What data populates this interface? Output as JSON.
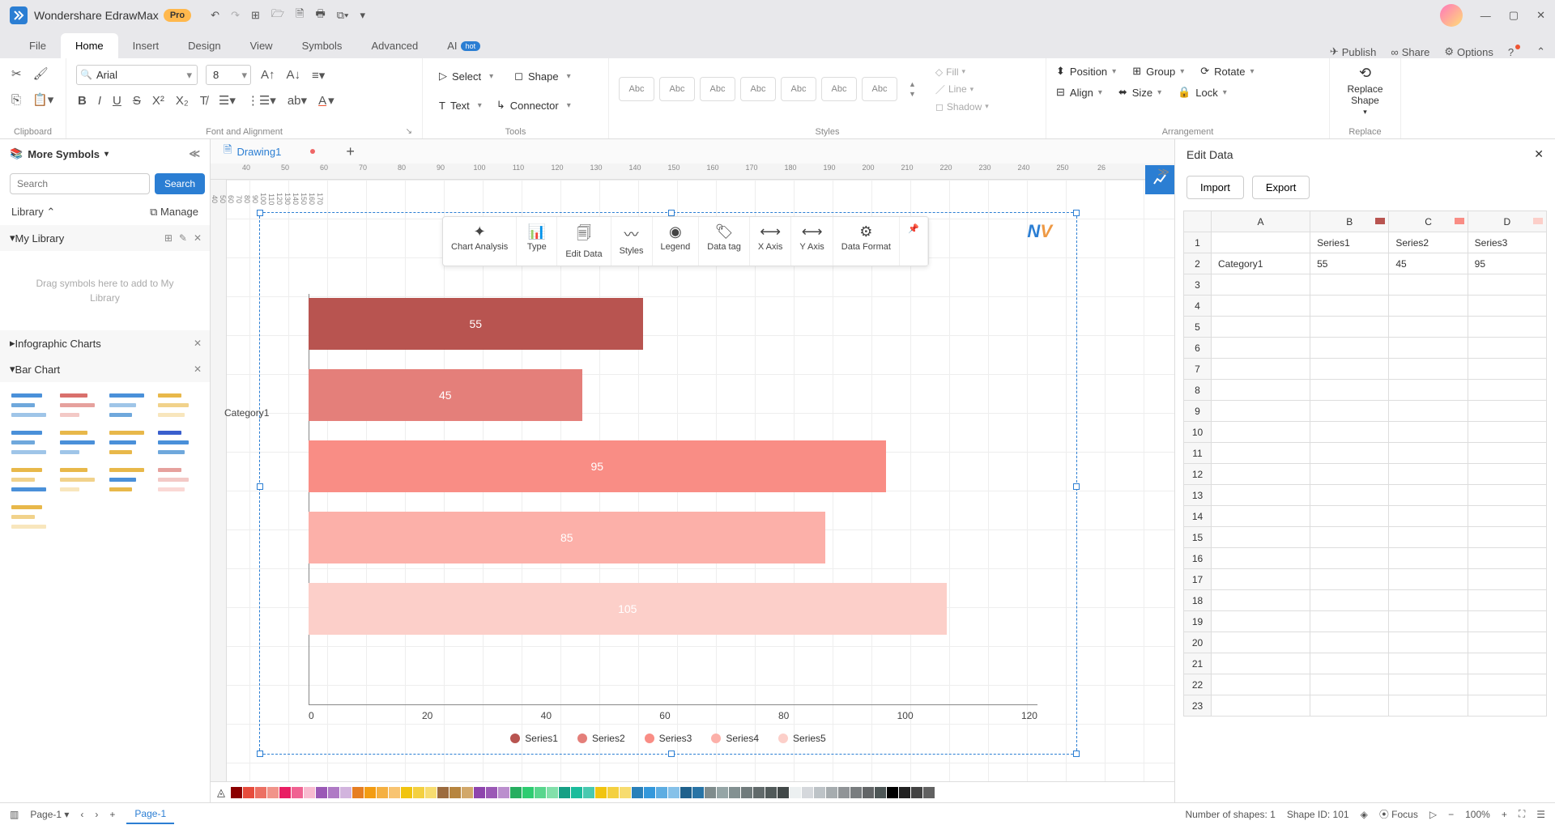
{
  "app": {
    "name": "Wondershare EdrawMax",
    "badge": "Pro"
  },
  "window_controls": {
    "minimize": "—",
    "maximize": "▢",
    "close": "✕"
  },
  "qat": [
    "↶",
    "↷",
    "⊞",
    "🗁",
    "🗎",
    "🖶",
    "⧉▾",
    "▾"
  ],
  "main_tabs": {
    "items": [
      "File",
      "Home",
      "Insert",
      "Design",
      "View",
      "Symbols",
      "Advanced"
    ],
    "active": "Home",
    "ai_label": "AI",
    "ai_badge": "hot"
  },
  "top_right_actions": {
    "publish": "Publish",
    "share": "Share",
    "options": "Options"
  },
  "ribbon": {
    "clipboard": {
      "label": "Clipboard"
    },
    "font_align": {
      "label": "Font and Alignment",
      "font": "Arial",
      "size": "8"
    },
    "tools": {
      "label": "Tools",
      "select": "Select",
      "shape": "Shape",
      "text": "Text",
      "connector": "Connector"
    },
    "styles": {
      "label": "Styles",
      "sample": "Abc",
      "count": 7,
      "fill": "Fill",
      "line": "Line",
      "shadow": "Shadow"
    },
    "arrangement": {
      "label": "Arrangement",
      "position": "Position",
      "group": "Group",
      "rotate": "Rotate",
      "align": "Align",
      "size": "Size",
      "lock": "Lock"
    },
    "replace": {
      "label": "Replace",
      "button": "Replace Shape"
    }
  },
  "doc_tabs": {
    "active": "Drawing1"
  },
  "ruler_h": [
    "40",
    "50",
    "60",
    "70",
    "80",
    "90",
    "100",
    "110",
    "120",
    "130",
    "140",
    "150",
    "160",
    "170",
    "180",
    "190",
    "200",
    "210",
    "220",
    "230",
    "240",
    "250",
    "26"
  ],
  "ruler_v": [
    "40",
    "50",
    "60",
    "70",
    "80",
    "90",
    "100",
    "110",
    "120",
    "130",
    "140",
    "150",
    "160",
    "170"
  ],
  "left_panel": {
    "title": "More Symbols",
    "search_placeholder": "Search",
    "search_btn": "Search",
    "library_label": "Library",
    "manage_label": "Manage",
    "mylib_label": "My Library",
    "dropzone": "Drag symbols here to add to My Library",
    "infographic_label": "Infographic Charts",
    "barchart_label": "Bar Chart"
  },
  "chart_toolbar": [
    "Chart Analysis",
    "Type",
    "Edit Data",
    "Styles",
    "Legend",
    "Data tag",
    "X Axis",
    "Y Axis",
    "Data Format"
  ],
  "chart_data": {
    "type": "bar",
    "orientation": "horizontal",
    "categories": [
      "Category1"
    ],
    "series": [
      {
        "name": "Series1",
        "value": 55,
        "color": "#b85450"
      },
      {
        "name": "Series2",
        "value": 45,
        "color": "#e47f7a"
      },
      {
        "name": "Series3",
        "value": 95,
        "color": "#f98d85"
      },
      {
        "name": "Series4",
        "value": 85,
        "color": "#fcb0a9"
      },
      {
        "name": "Series5",
        "value": 105,
        "color": "#fccfc9"
      }
    ],
    "xlim": [
      0,
      120
    ],
    "xticks": [
      0,
      20,
      40,
      60,
      80,
      100,
      120
    ],
    "xlabel": "",
    "ylabel": "",
    "title": ""
  },
  "right_panel": {
    "title": "Edit Data",
    "import": "Import",
    "export": "Export",
    "columns": [
      {
        "label": "A",
        "swatch": ""
      },
      {
        "label": "B",
        "swatch": "#b85450"
      },
      {
        "label": "C",
        "swatch": "#f98d85"
      },
      {
        "label": "D",
        "swatch": "#fccfc9"
      }
    ],
    "header_row": [
      "",
      "Series1",
      "Series2",
      "Series3"
    ],
    "data_row": [
      "Category1",
      "55",
      "45",
      "95"
    ],
    "row_count": 23
  },
  "statusbar": {
    "page_label": "Page-1",
    "active_page": "Page-1",
    "shapes_count": "Number of shapes: 1",
    "shape_id": "Shape ID: 101",
    "focus": "Focus",
    "zoom": "100%"
  },
  "palette_colors": [
    "#8b0000",
    "#e74c3c",
    "#ec7063",
    "#f1948a",
    "#e91e63",
    "#f06292",
    "#f8bbd0",
    "#9b59b6",
    "#af7ac5",
    "#d2b4de",
    "#e67e22",
    "#f39c12",
    "#f5b041",
    "#f8c471",
    "#f1c40f",
    "#f4d03f",
    "#f7dc6f",
    "#9c6b3e",
    "#b7853f",
    "#d2a86a",
    "#8e44ad",
    "#9b59b6",
    "#bb8fce",
    "#27ae60",
    "#2ecc71",
    "#58d68d",
    "#82e0aa",
    "#16a085",
    "#1abc9c",
    "#48c9b0",
    "#f1c40f",
    "#f4d03f",
    "#f7dc6f",
    "#2980b9",
    "#3498db",
    "#5dade2",
    "#85c1e9",
    "#1f618d",
    "#2874a6",
    "#7f8c8d",
    "#95a5a6",
    "#839192",
    "#707b7c",
    "#616a6b",
    "#515a5a",
    "#424949",
    "#ecf0f1",
    "#d5d8dc",
    "#bdc3c7",
    "#a6acaf",
    "#909497",
    "#797d7f",
    "#626567",
    "#4d5656",
    "#000000",
    "#212121",
    "#424242",
    "#616161",
    "#ffffff"
  ]
}
